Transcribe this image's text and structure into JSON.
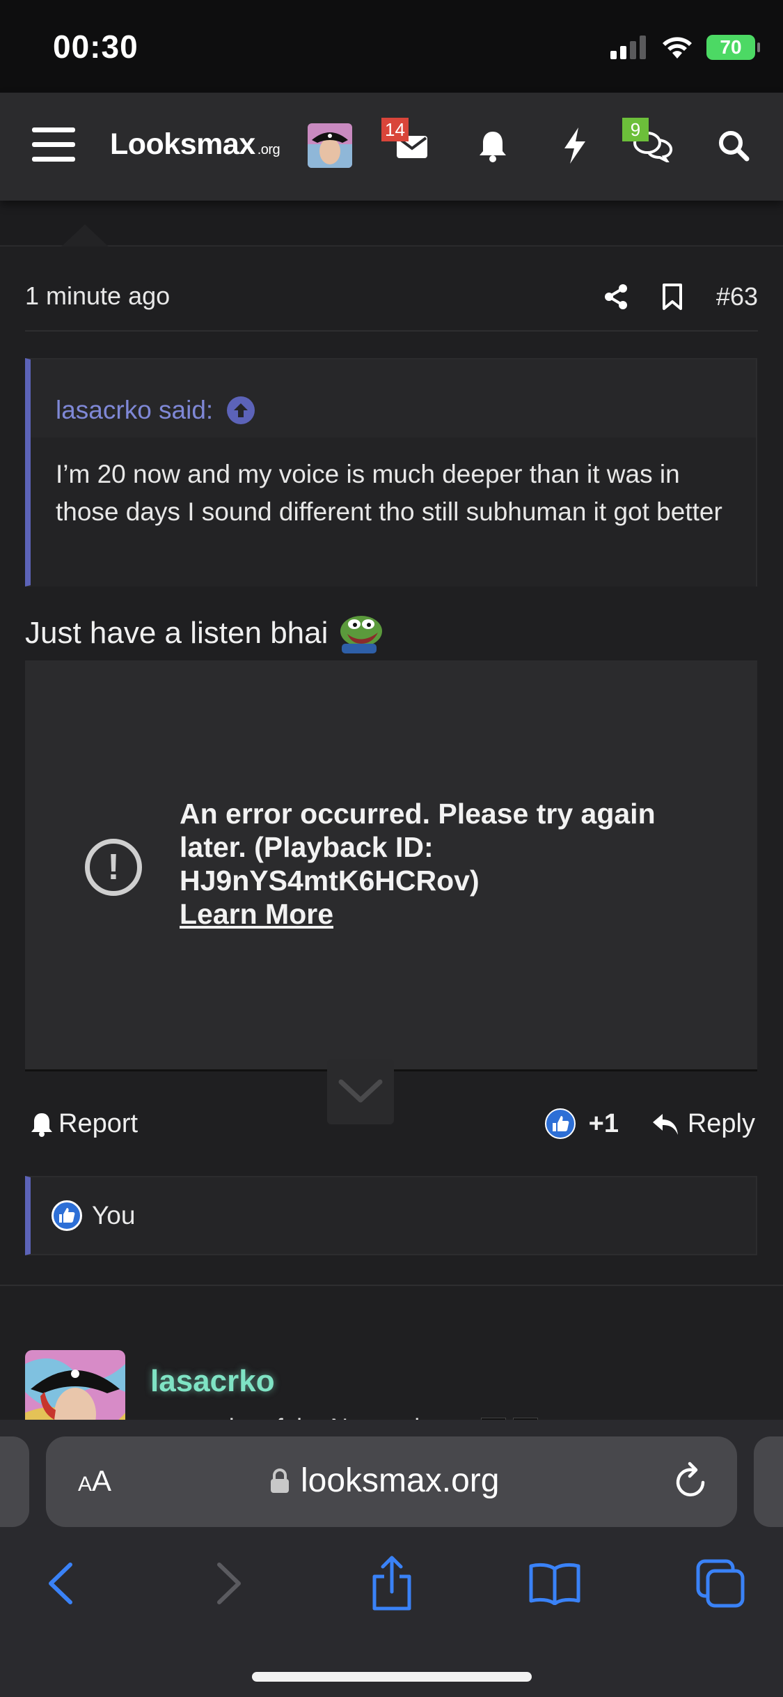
{
  "status_bar": {
    "time": "00:30",
    "battery": "70"
  },
  "header": {
    "logo": "Looksmax",
    "logo_suffix": ".org",
    "inbox_badge": "14",
    "chats_badge": "9",
    "icons": [
      "menu-icon",
      "inbox-icon",
      "bell-icon",
      "bolt-icon",
      "chat-icon",
      "search-icon"
    ]
  },
  "post": {
    "time": "1 minute ago",
    "number": "#63",
    "quote": {
      "author_line": "lasacrko said:",
      "text": "I’m 20 now and my voice is much deeper than it was in those days I sound different tho still subhuman it got better"
    },
    "text": "Just have a listen bhai",
    "video_error": {
      "message": "An error occurred. Please try again later. (Playback ID: HJ9nYS4mtK6HCRov)",
      "link": "Learn More"
    },
    "actions": {
      "report": "Report",
      "reactions": "+1",
      "reply": "Reply"
    },
    "liked_by": "You"
  },
  "next_post": {
    "username": "lasacrko",
    "user_title": "counselor of the Narcy pirates",
    "title_flags": [
      "☠",
      "☠"
    ]
  },
  "browser": {
    "aa_label_small": "A",
    "aa_label": "A",
    "url": "looksmax.org"
  },
  "colors": {
    "accent": "#5c63b8",
    "username": "#7fe3c4",
    "badge_red": "#d9453a",
    "badge_green": "#6cbf3a",
    "link_blue": "#3a82f7"
  }
}
